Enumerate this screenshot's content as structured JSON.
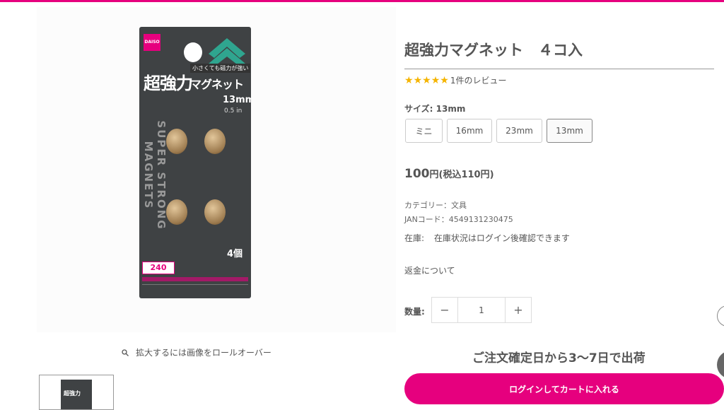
{
  "product": {
    "title": "超強力マグネット　４コ入",
    "rating_stars": 5,
    "review_text": "1件のレビュー",
    "size_label": "サイズ: 13mm",
    "sizes": [
      "ミニ",
      "16mm",
      "23mm",
      "13mm"
    ],
    "selected_size": "13mm",
    "price": "100",
    "price_suffix": "円(税込110円)",
    "category": "カテゴリー：文具",
    "jan": "JANコード：4549131230475",
    "stock_label": "在庫:",
    "stock_text": "在庫状況はログイン後確認できます",
    "refund_link": "返金について",
    "qty_label": "数量:",
    "qty_value": "1",
    "shipping": "ご注文確定日から3〜7日で出荷",
    "cart_button": "ログインしてカートに入れる"
  },
  "gallery": {
    "zoom_hint": "拡大するには画像をロールオーバー"
  },
  "package_art": {
    "logo": "DAISO",
    "subtitle": "小さくても磁力が強い",
    "title1": "超強力",
    "title2": "マグネット",
    "size": "13mm",
    "inch": "0.5 in",
    "vertical": "SUPER STRONG MAGNETS",
    "count": "4個",
    "price": "240",
    "thumb_text": "超強力"
  },
  "colors": {
    "accent": "#e6007e",
    "star": "#f5b400"
  },
  "icons": {
    "zoom": "search-icon",
    "minus": "minus-icon",
    "plus": "plus-icon",
    "star": "star-icon"
  }
}
